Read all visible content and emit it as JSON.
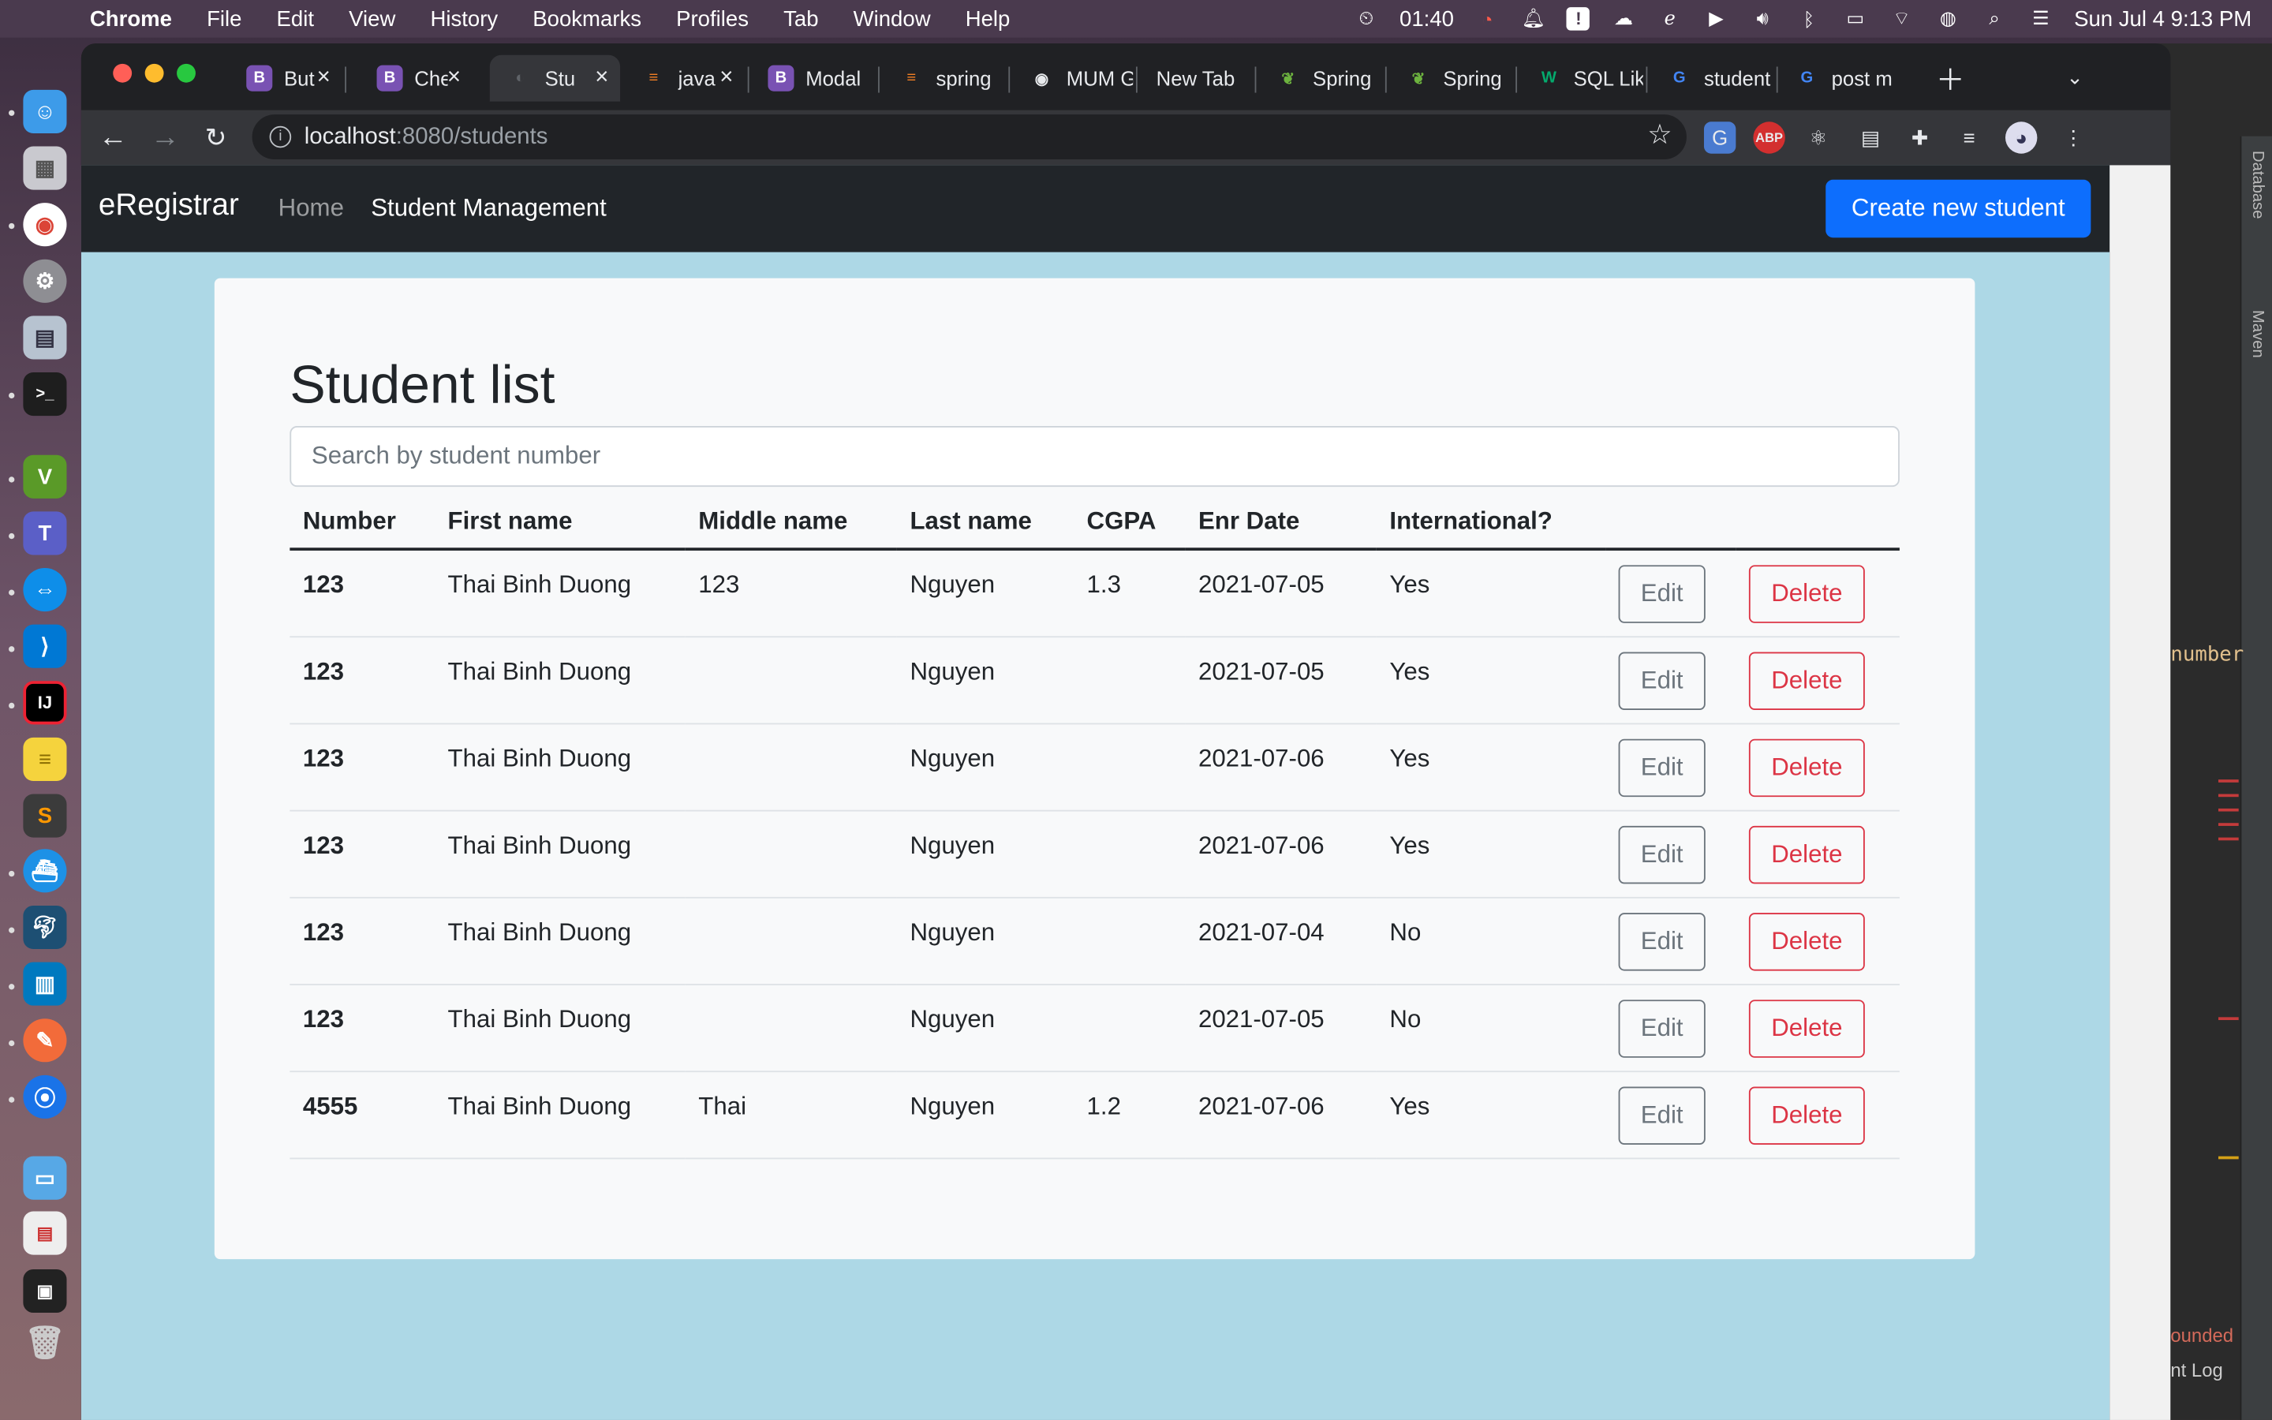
{
  "menubar": {
    "app": "Chrome",
    "items": [
      "File",
      "Edit",
      "View",
      "History",
      "Bookmarks",
      "Profiles",
      "Tab",
      "Window",
      "Help"
    ],
    "timer": "01:40",
    "clock": "Sun Jul 4  9:13 PM"
  },
  "tabs": [
    {
      "label": "But",
      "fav": "B",
      "color": "#7952b3"
    },
    {
      "label": "Che",
      "fav": "B",
      "color": "#7952b3"
    },
    {
      "label": "Stu",
      "fav": "◐",
      "color": "#5f6368"
    },
    {
      "label": "java",
      "fav": "≡",
      "color": "#f48024"
    },
    {
      "label": "Modal",
      "fav": "B",
      "color": "#7952b3"
    },
    {
      "label": "spring",
      "fav": "≡",
      "color": "#f48024"
    },
    {
      "label": "MUM G",
      "fav": "◉",
      "color": "#e8eaed"
    },
    {
      "label": "New Tab",
      "fav": "",
      "color": ""
    },
    {
      "label": "Spring",
      "fav": "❦",
      "color": "#6db33f"
    },
    {
      "label": "Spring",
      "fav": "❦",
      "color": "#6db33f"
    },
    {
      "label": "SQL Lik",
      "fav": "W",
      "color": "#04aa6d"
    },
    {
      "label": "student",
      "fav": "G",
      "color": "#4285f4"
    },
    {
      "label": "post m",
      "fav": "G",
      "color": "#4285f4"
    }
  ],
  "address": {
    "host": "localhost",
    "path": ":8080/students"
  },
  "navbar": {
    "brand": "eRegistrar",
    "links": [
      "Home",
      "Student Management"
    ],
    "create_button": "Create new student"
  },
  "main": {
    "title": "Student list",
    "search_placeholder": "Search by student number",
    "columns": [
      "Number",
      "First name",
      "Middle name",
      "Last name",
      "CGPA",
      "Enr Date",
      "International?"
    ],
    "edit_label": "Edit",
    "delete_label": "Delete",
    "rows": [
      {
        "number": "123",
        "first": "Thai Binh Duong",
        "middle": "123",
        "last": "Nguyen",
        "cgpa": "1.3",
        "date": "2021-07-05",
        "intl": "Yes"
      },
      {
        "number": "123",
        "first": "Thai Binh Duong",
        "middle": "",
        "last": "Nguyen",
        "cgpa": "",
        "date": "2021-07-05",
        "intl": "Yes"
      },
      {
        "number": "123",
        "first": "Thai Binh Duong",
        "middle": "",
        "last": "Nguyen",
        "cgpa": "",
        "date": "2021-07-06",
        "intl": "Yes"
      },
      {
        "number": "123",
        "first": "Thai Binh Duong",
        "middle": "",
        "last": "Nguyen",
        "cgpa": "",
        "date": "2021-07-06",
        "intl": "Yes"
      },
      {
        "number": "123",
        "first": "Thai Binh Duong",
        "middle": "",
        "last": "Nguyen",
        "cgpa": "",
        "date": "2021-07-04",
        "intl": "No"
      },
      {
        "number": "123",
        "first": "Thai Binh Duong",
        "middle": "",
        "last": "Nguyen",
        "cgpa": "",
        "date": "2021-07-05",
        "intl": "No"
      },
      {
        "number": "4555",
        "first": "Thai Binh Duong",
        "middle": "Thai",
        "last": "Nguyen",
        "cgpa": "1.2",
        "date": "2021-07-06",
        "intl": "Yes"
      }
    ]
  },
  "ide": {
    "tool_windows": [
      "Database",
      "Maven"
    ],
    "code_fragment": "number",
    "log_lines": [
      "ounded",
      "nt Log"
    ]
  },
  "colors": {
    "navbar": "#212529",
    "primary": "#0d6efd",
    "danger": "#dc3545",
    "secondary": "#6c757d",
    "page_bg": "#add8e6"
  }
}
